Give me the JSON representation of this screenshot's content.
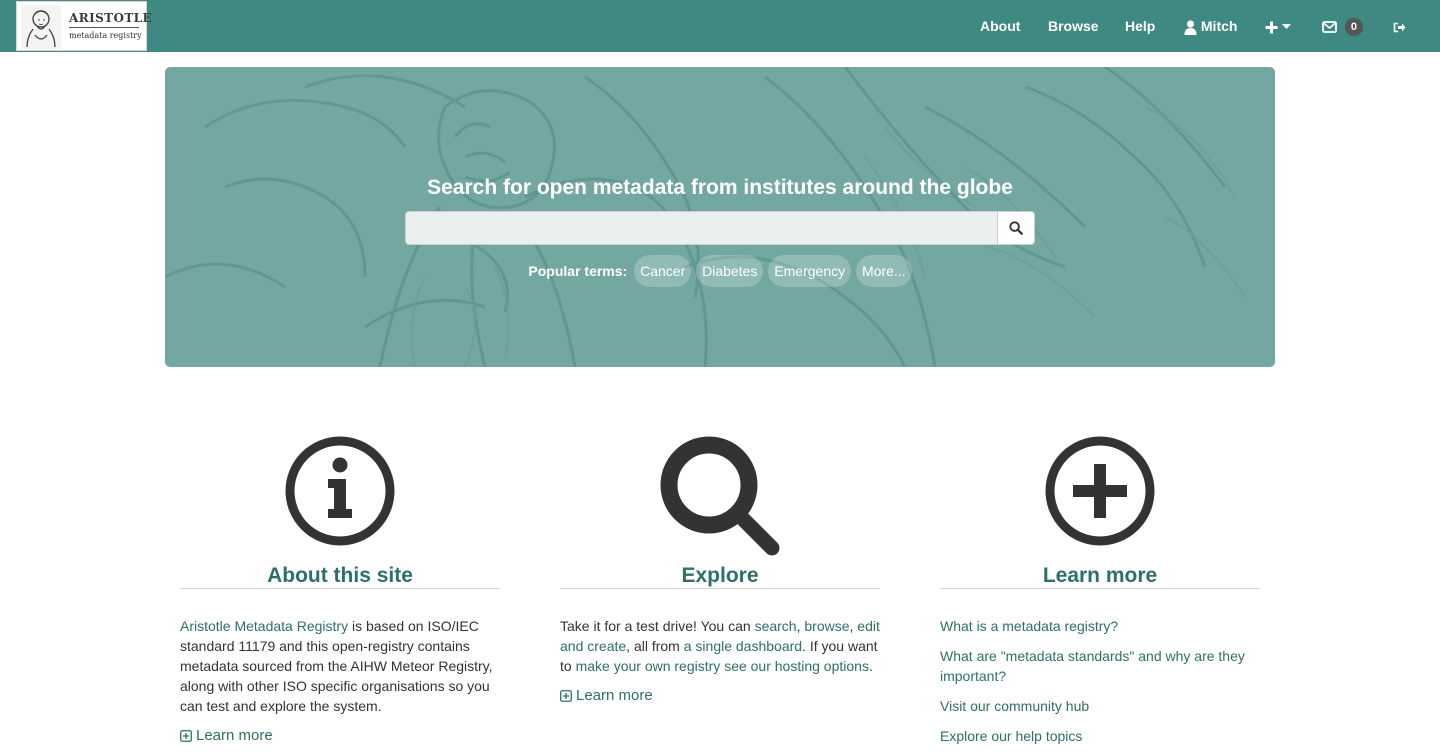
{
  "brand": {
    "title": "ARISTOTLE",
    "subtitle": "metadata registry",
    "logo_icon": "aristotle-bust-icon"
  },
  "nav": {
    "about": "About",
    "browse": "Browse",
    "help": "Help",
    "user": "Mitch",
    "user_icon": "user-icon",
    "add_icon": "plus-icon",
    "inbox_icon": "envelope-icon",
    "inbox_count": "0",
    "logout_icon": "sign-out-icon"
  },
  "hero": {
    "title": "Search for open metadata from institutes around the globe",
    "search_value": "",
    "search_icon": "search-icon",
    "popular_label": "Popular terms:",
    "terms": [
      "Cancer",
      "Diabetes",
      "Emergency",
      "More..."
    ]
  },
  "about": {
    "heading": "About this site",
    "icon": "info-circle-icon",
    "link_text": "Aristotle Metadata Registry",
    "body": " is based on ISO/IEC standard 11179 and this open-registry contains metadata sourced from the AIHW Meteor Registry, along with other ISO specific organisations so you can test and explore the system.",
    "learn_more": "Learn more"
  },
  "explore": {
    "heading": "Explore",
    "icon": "magnifier-icon",
    "t1": "Take it for a test drive! You can ",
    "search_link": "search",
    "t2": ", ",
    "browse_link": "browse",
    "t3": ", ",
    "edit_link": "edit and create",
    "t4": ", all from ",
    "dashboard_link": "a single dashboard",
    "t5": ". If you want to ",
    "registry_link": "make your own registry",
    "t6": " ",
    "hosting_link": "see our hosting options",
    "t7": ".",
    "learn_more": "Learn more"
  },
  "learn": {
    "heading": "Learn more",
    "icon": "plus-circle-icon",
    "links": [
      "What is a metadata registry?",
      "What are \"metadata standards\" and why are they important?",
      "Visit our community hub",
      "Explore our help topics"
    ]
  },
  "colors": {
    "navbar": "#3e8982",
    "hero": "#72a8a1",
    "accent": "#2e7068",
    "icon": "#333333"
  }
}
